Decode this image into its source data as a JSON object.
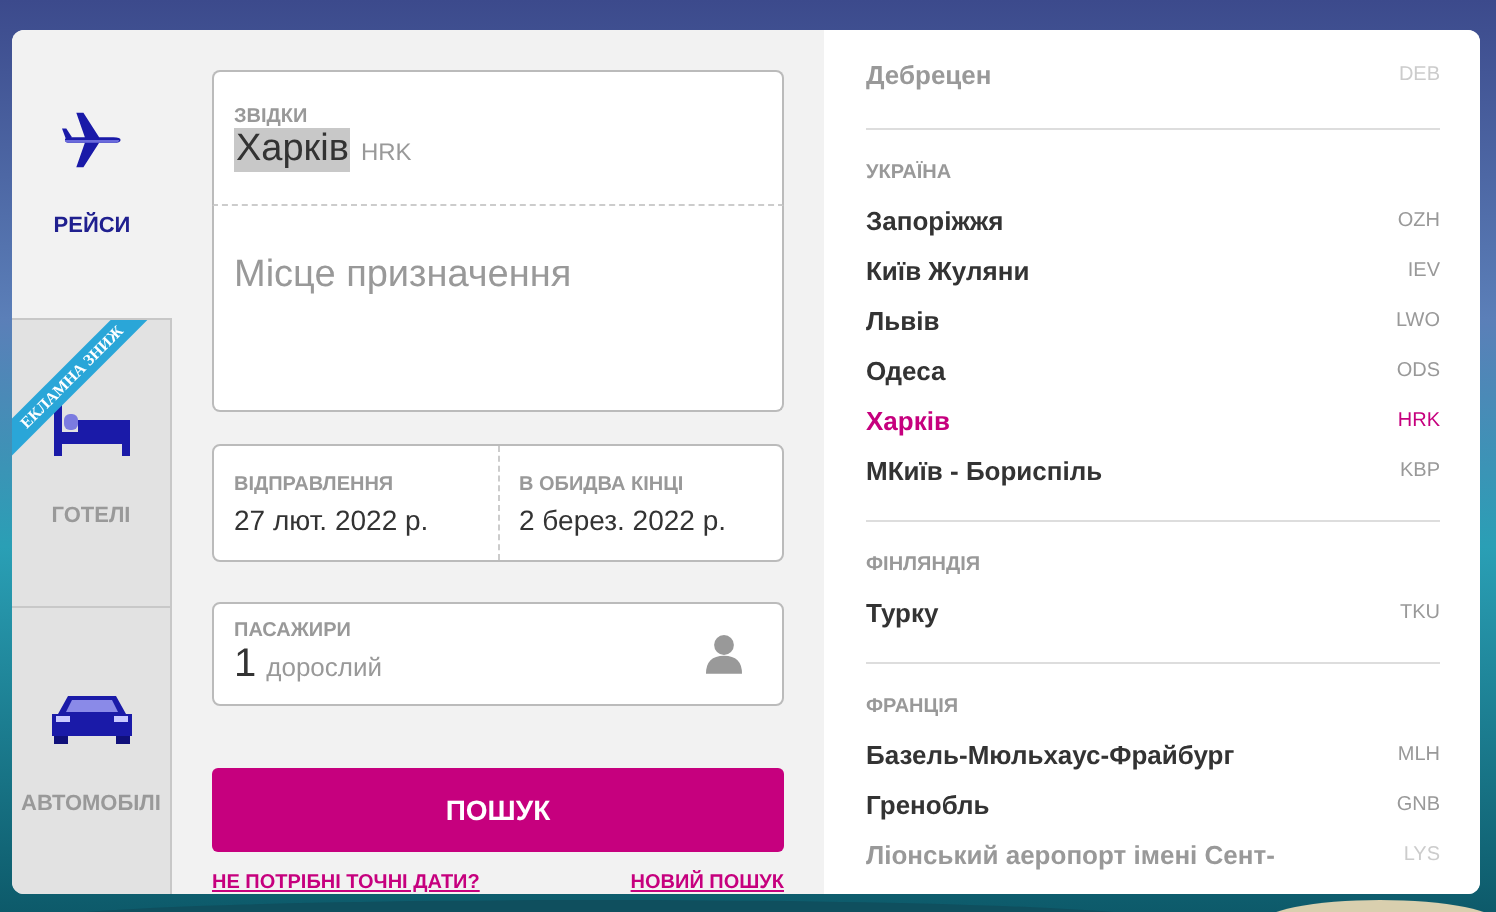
{
  "tabs": [
    {
      "label": "РЕЙСИ",
      "kind": "plane",
      "selected": true
    },
    {
      "label": "ГОТЕЛІ",
      "kind": "bed",
      "selected": false,
      "ribbon": "ЕКЛАМНА ЗНИЖ"
    },
    {
      "label": "АВТОМОБІЛІ",
      "kind": "car",
      "selected": false
    }
  ],
  "form": {
    "origin": {
      "label": "ЗВІДКИ",
      "value": "Харків",
      "code": "HRK",
      "highlighted": true
    },
    "destination": {
      "placeholder": "Місце призначення"
    },
    "departure": {
      "label": "ВІДПРАВЛЕННЯ",
      "value": "27 лют. 2022 р."
    },
    "return": {
      "label": "В ОБИДВА КІНЦІ",
      "value": "2 берез. 2022 р."
    },
    "passengers": {
      "label": "ПАСАЖИРИ",
      "count": "1",
      "unit": "дорослий"
    },
    "search_button": "ПОШУК",
    "links": [
      "НЕ ПОТРІБНІ ТОЧНІ ДАТИ?",
      "НОВИЙ ПОШУК"
    ]
  },
  "airport_list": {
    "groups": [
      {
        "airports": [
          {
            "name": "Дебрецен",
            "code": "DEB",
            "selected": false,
            "faded": true
          }
        ]
      },
      {
        "country": "УКРАЇНА",
        "airports": [
          {
            "name": "Запоріжжя",
            "code": "OZH",
            "selected": false,
            "faded": false
          },
          {
            "name": "Київ Жуляни",
            "code": "IEV",
            "selected": false,
            "faded": false
          },
          {
            "name": "Львів",
            "code": "LWO",
            "selected": false,
            "faded": false
          },
          {
            "name": "Одеса",
            "code": "ODS",
            "selected": false,
            "faded": false
          },
          {
            "name": "Харків",
            "code": "HRK",
            "selected": true,
            "faded": false
          },
          {
            "name": "МКиїв - Бориспіль",
            "code": "KBP",
            "selected": false,
            "faded": false
          }
        ]
      },
      {
        "country": "ФІНЛЯНДІЯ",
        "airports": [
          {
            "name": "Турку",
            "code": "TKU",
            "selected": false,
            "faded": false
          }
        ]
      },
      {
        "country": "ФРАНЦІЯ",
        "airports": [
          {
            "name": "Базель-Мюльхаус-Фрайбург",
            "code": "MLH",
            "selected": false,
            "faded": false
          },
          {
            "name": "Гренобль",
            "code": "GNB",
            "selected": false,
            "faded": false
          },
          {
            "name": "Ліонський аеропорт імені Сент-",
            "code": "LYS",
            "selected": false,
            "faded": true
          }
        ]
      }
    ]
  }
}
